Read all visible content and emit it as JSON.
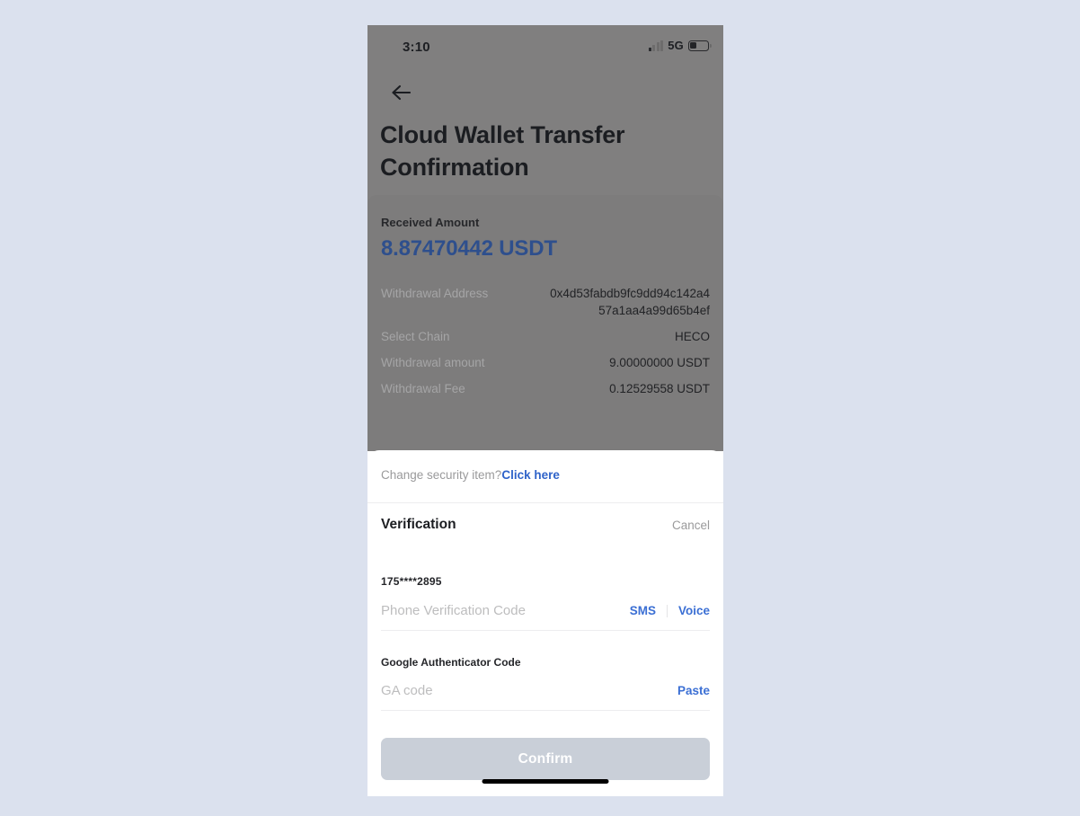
{
  "status_bar": {
    "time": "3:10",
    "network": "5G",
    "signal_icon": "signal-bars-icon",
    "battery_icon": "battery-icon"
  },
  "header": {
    "back_icon": "back-arrow-icon",
    "title": "Cloud Wallet Transfer Confirmation"
  },
  "amount_card": {
    "label": "Received Amount",
    "value": "8.87470442 USDT",
    "value_color": "#2e4f8d",
    "details": [
      {
        "key": "Withdrawal Address",
        "value": "0x4d53fabdb9fc9dd94c142a457a1aa4a99d65b4ef"
      },
      {
        "key": "Select Chain",
        "value": "HECO"
      },
      {
        "key": "Withdrawal amount",
        "value": "9.00000000 USDT"
      },
      {
        "key": "Withdrawal Fee",
        "value": "0.12529558 USDT"
      }
    ]
  },
  "sheet": {
    "change_security_text": "Change security item?",
    "change_security_link": "Click here",
    "verification_title": "Verification",
    "cancel_label": "Cancel",
    "phone_masked": "175****2895",
    "phone_placeholder": "Phone Verification Code",
    "phone_value": "",
    "sms_label": "SMS",
    "voice_label": "Voice",
    "ga_label": "Google Authenticator Code",
    "ga_placeholder": "GA code",
    "ga_value": "",
    "paste_label": "Paste",
    "confirm_label": "Confirm",
    "confirm_enabled": false,
    "link_color": "#3b6fd4"
  }
}
